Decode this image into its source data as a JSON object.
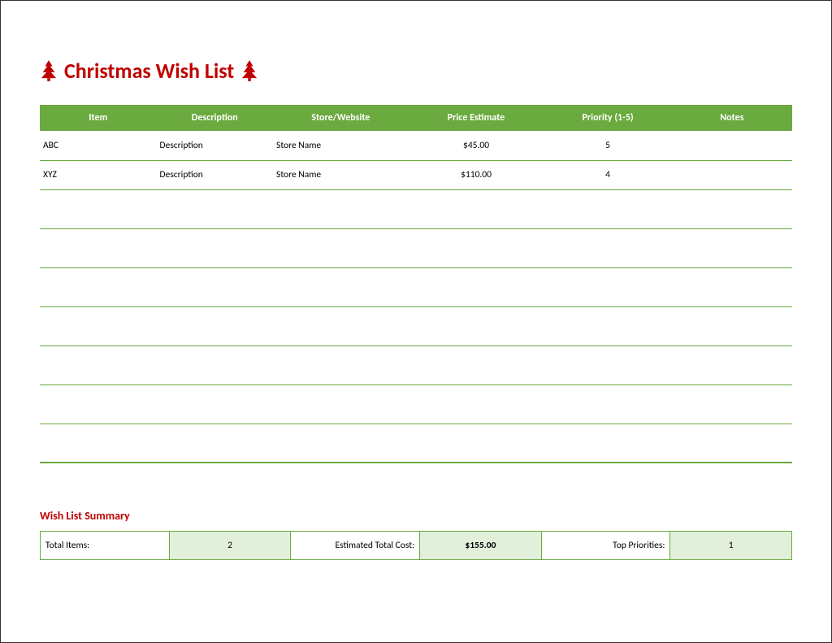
{
  "title": "Christmas Wish List",
  "headers": {
    "item": "Item",
    "description": "Description",
    "store": "Store/Website",
    "price": "Price Estimate",
    "priority": "Priority (1-5)",
    "notes": "Notes"
  },
  "rows": [
    {
      "item": "ABC",
      "description": "Description",
      "store": "Store Name",
      "price": "$45.00",
      "priority": "5",
      "notes": ""
    },
    {
      "item": "XYZ",
      "description": "Description",
      "store": "Store Name",
      "price": "$110.00",
      "priority": "4",
      "notes": ""
    }
  ],
  "emptyRowCount": 7,
  "summaryTitle": "Wish List Summary",
  "summary": {
    "totalItemsLabel": "Total Items:",
    "totalItems": "2",
    "estCostLabel": "Estimated Total Cost:",
    "estCost": "$155.00",
    "topPrioLabel": "Top Priorities:",
    "topPrio": "1"
  }
}
